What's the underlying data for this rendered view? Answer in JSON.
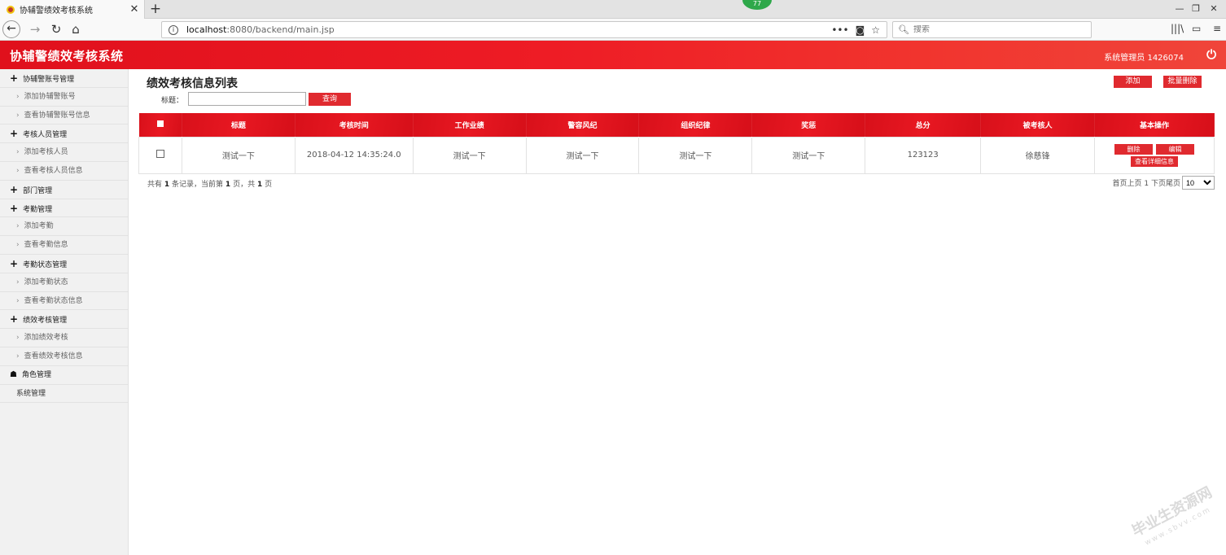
{
  "browser": {
    "tab_title": "协辅警绩效考核系统",
    "tab_close": "✕",
    "new_tab": "+",
    "notif_badge": "77",
    "url_host": "localhost",
    "url_path": ":8080/backend/main.jsp",
    "url_more": "•••",
    "search_placeholder": "搜索"
  },
  "header": {
    "title": "协辅警绩效考核系统",
    "user": "系统管理员 1426074"
  },
  "sidebar": {
    "items": [
      {
        "type": "group",
        "label": "协辅警账号管理"
      },
      {
        "type": "sub",
        "label": "添加协辅警账号"
      },
      {
        "type": "sub",
        "label": "查看协辅警账号信息"
      },
      {
        "type": "group",
        "label": "考核人员管理"
      },
      {
        "type": "sub",
        "label": "添加考核人员"
      },
      {
        "type": "sub",
        "label": "查看考核人员信息"
      },
      {
        "type": "group",
        "label": "部门管理"
      },
      {
        "type": "group",
        "label": "考勤管理"
      },
      {
        "type": "sub",
        "label": "添加考勤"
      },
      {
        "type": "sub",
        "label": "查看考勤信息"
      },
      {
        "type": "group",
        "label": "考勤状态管理"
      },
      {
        "type": "sub",
        "label": "添加考勤状态"
      },
      {
        "type": "sub",
        "label": "查看考勤状态信息"
      },
      {
        "type": "group",
        "label": "绩效考核管理"
      },
      {
        "type": "sub",
        "label": "添加绩效考核"
      },
      {
        "type": "sub",
        "label": "查看绩效考核信息"
      },
      {
        "type": "group-icon",
        "label": "角色管理"
      },
      {
        "type": "plain",
        "label": "系统管理"
      }
    ]
  },
  "main": {
    "title": "绩效考核信息列表",
    "filter_label": "标题：",
    "filter_value": "",
    "query_button": "查询",
    "add_button": "添加",
    "batch_delete_button": "批量删除",
    "columns": [
      "标题",
      "考核时间",
      "工作业绩",
      "警容风纪",
      "组织纪律",
      "奖惩",
      "总分",
      "被考核人",
      "基本操作"
    ],
    "rows": [
      {
        "title": "测试一下",
        "time": "2018-04-12 14:35:24.0",
        "performance": "测试一下",
        "appearance": "测试一下",
        "discipline": "测试一下",
        "reward": "测试一下",
        "score": "123123",
        "person": "徐慈锋",
        "ops": {
          "delete": "删除",
          "edit": "编辑",
          "detail": "查看详细信息"
        }
      }
    ],
    "pager": {
      "prefix": "共有",
      "total": "1",
      "mid1": "条记录，当前第",
      "current": "1",
      "mid2": "页，共",
      "pages": "1",
      "suffix": "页",
      "links": "首页上页 1 下页尾页",
      "page_size": "10"
    }
  },
  "watermark": {
    "main": "毕业生资源网",
    "sub": "www.sbvv.com"
  }
}
